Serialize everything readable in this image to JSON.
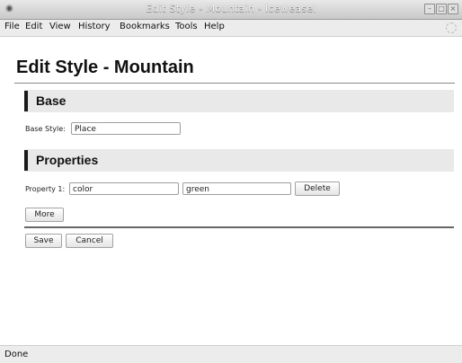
{
  "window": {
    "title": "Edit Style - Mountain - Iceweasel",
    "app_icon": "firefox-icon",
    "controls": [
      "minimize-icon",
      "maximize-icon",
      "close-icon"
    ]
  },
  "menubar": {
    "items": [
      "File",
      "Edit",
      "View",
      "History",
      "Bookmarks",
      "Tools",
      "Help"
    ]
  },
  "page": {
    "heading": "Edit Style - Mountain",
    "base_section": {
      "title": "Base",
      "base_style_label": "Base Style:",
      "base_style_value": "Place"
    },
    "properties_section": {
      "title": "Properties",
      "property_label": "Property 1:",
      "property_name_value": "color",
      "property_value_value": "green",
      "delete_label": "Delete",
      "more_label": "More"
    },
    "actions": {
      "save_label": "Save",
      "cancel_label": "Cancel"
    }
  },
  "statusbar": {
    "text": "Done"
  }
}
